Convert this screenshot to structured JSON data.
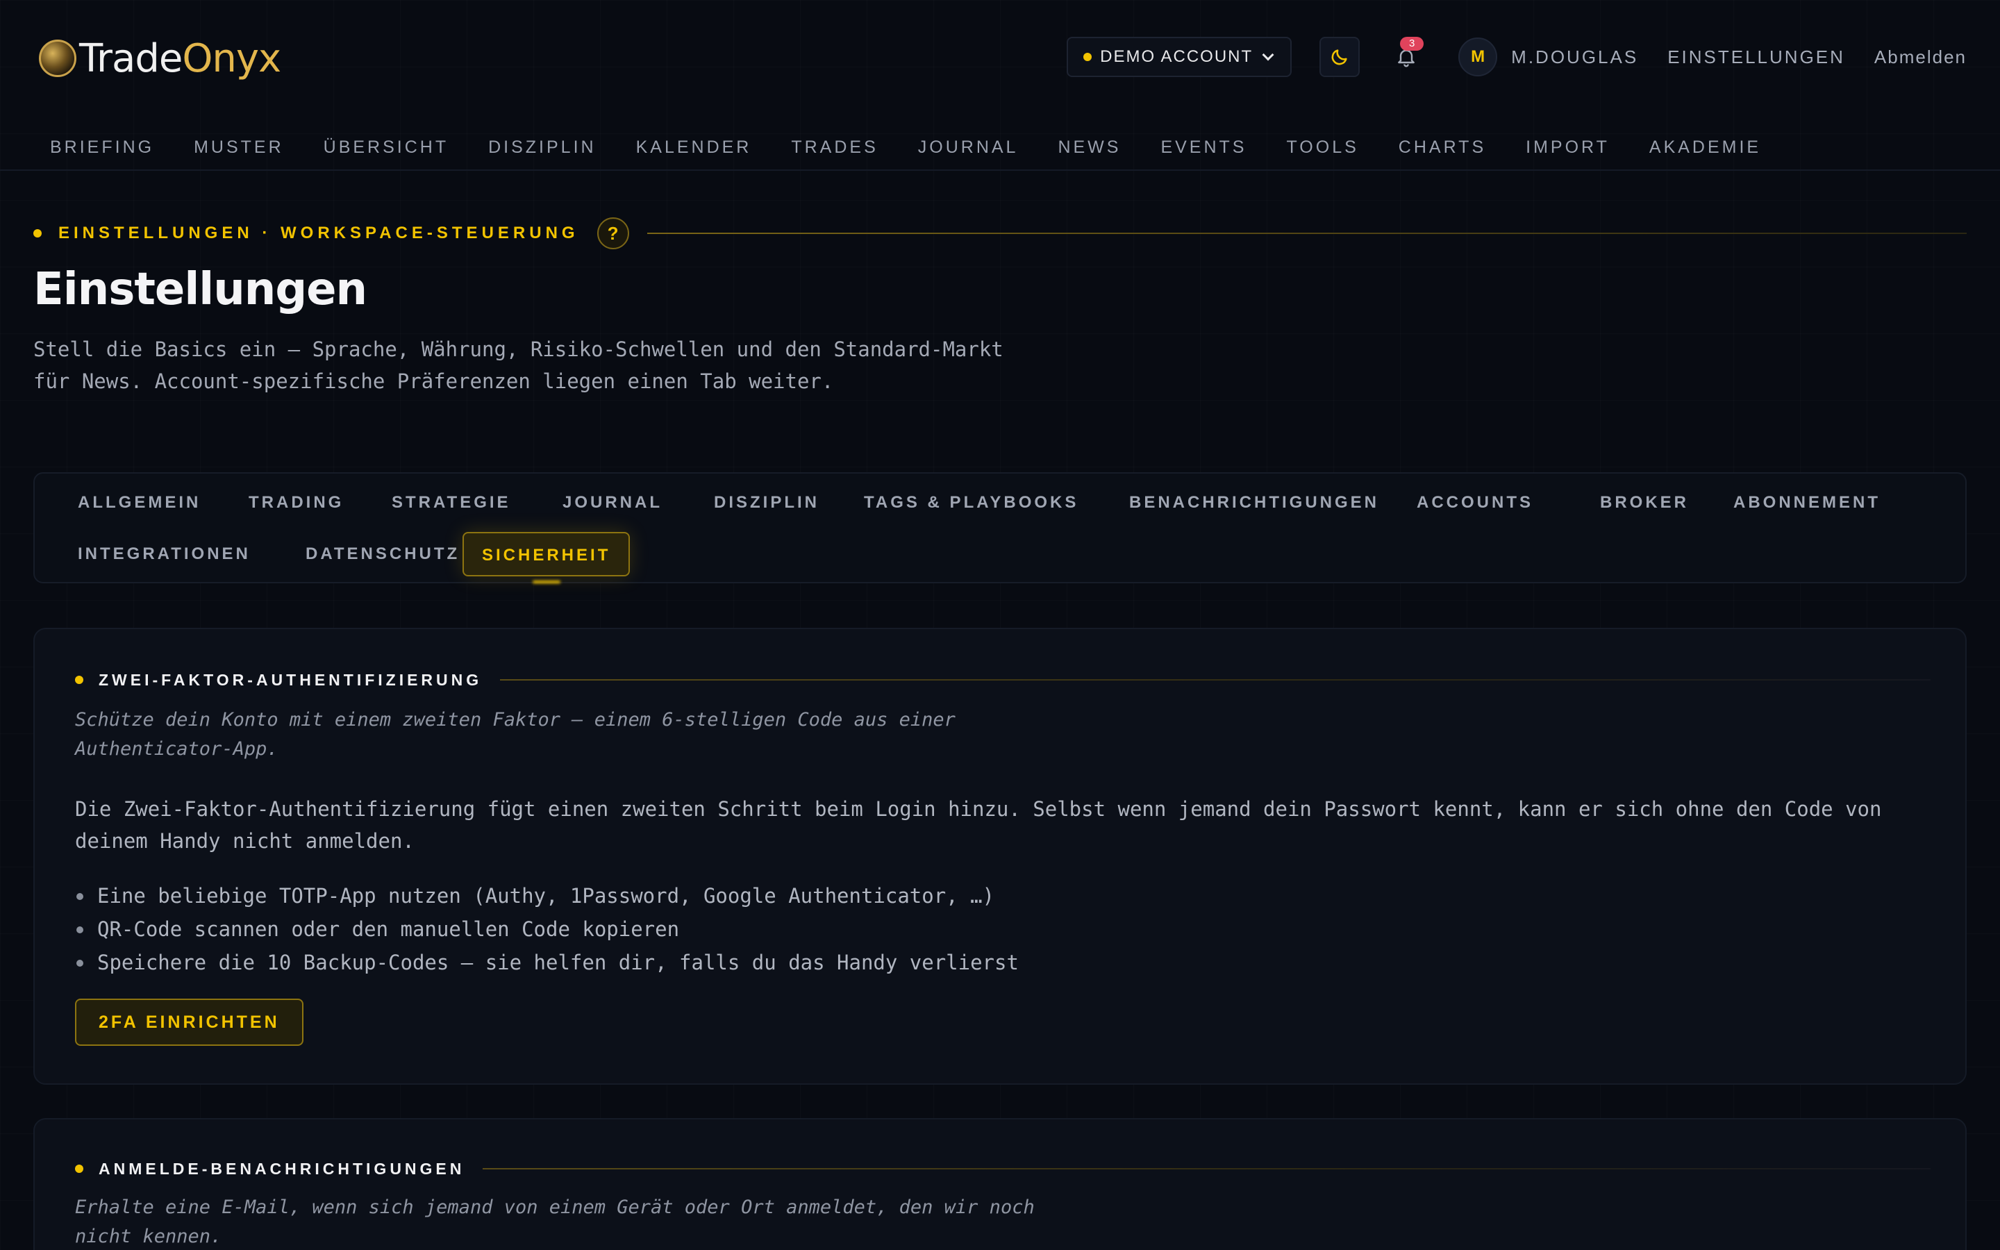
{
  "brand": {
    "name_part1": "Trade",
    "name_part2": "Onyx"
  },
  "header": {
    "account_label": "DEMO ACCOUNT",
    "notification_count": "3",
    "avatar_initial": "M",
    "username": "M.DOUGLAS",
    "settings_link": "EINSTELLUNGEN",
    "logout_link": "Abmelden"
  },
  "nav": [
    "BRIEFING",
    "MUSTER",
    "ÜBERSICHT",
    "DISZIPLIN",
    "KALENDER",
    "TRADES",
    "JOURNAL",
    "NEWS",
    "EVENTS",
    "TOOLS",
    "CHARTS",
    "IMPORT",
    "AKADEMIE"
  ],
  "section": {
    "eyebrow": "EINSTELLUNGEN · WORKSPACE-STEUERUNG",
    "help_label": "?",
    "title": "Einstellungen",
    "subtitle": "Stell die Basics ein — Sprache, Währung, Risiko-Schwellen und den Standard-Markt für News. Account-spezifische Präferenzen liegen einen Tab weiter."
  },
  "tabs": [
    "ALLGEMEIN",
    "TRADING",
    "STRATEGIE",
    "JOURNAL",
    "DISZIPLIN",
    "TAGS & PLAYBOOKS",
    "BENACHRICHTIGUNGEN",
    "ACCOUNTS",
    "BROKER",
    "ABONNEMENT",
    "INTEGRATIONEN",
    "DATENSCHUTZ",
    "SICHERHEIT"
  ],
  "active_tab": "SICHERHEIT",
  "twofa": {
    "title": "ZWEI-FAKTOR-AUTHENTIFIZIERUNG",
    "description": "Schütze dein Konto mit einem zweiten Faktor — einem 6-stelligen Code aus einer Authenticator-App.",
    "body": "Die Zwei-Faktor-Authentifizierung fügt einen zweiten Schritt beim Login hinzu. Selbst wenn jemand dein Passwort kennt, kann er sich ohne den Code von deinem Handy nicht anmelden.",
    "bullets": [
      "Eine beliebige TOTP-App nutzen (Authy, 1Password, Google Authenticator, …)",
      "QR-Code scannen oder den manuellen Code kopieren",
      "Speichere die 10 Backup-Codes — sie helfen dir, falls du das Handy verlierst"
    ],
    "button": "2FA EINRICHTEN"
  },
  "login_alerts": {
    "title": "ANMELDE-BENACHRICHTIGUNGEN",
    "description": "Erhalte eine E-Mail, wenn sich jemand von einem Gerät oder Ort anmeldet, den wir noch nicht kennen."
  },
  "colors": {
    "accent": "#f2c300",
    "background": "#080b12",
    "badge": "#e0435c"
  }
}
